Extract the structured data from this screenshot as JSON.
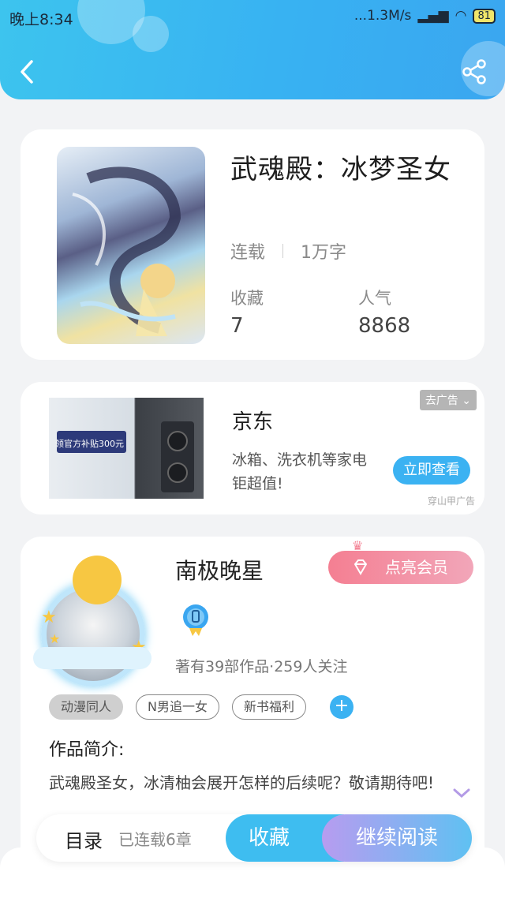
{
  "status_bar": {
    "time": "晚上8:34",
    "network_speed": "...1.3M/s",
    "battery": "81"
  },
  "header": {
    "back_icon": "back-arrow-icon",
    "share_icon": "share-icon",
    "accent_color": "#38b2f2"
  },
  "book": {
    "title": "武魂殿：冰梦圣女",
    "status": "连载",
    "word_count": "1万字",
    "favorites_label": "收藏",
    "favorites_value": "7",
    "popularity_label": "人气",
    "popularity_value": "8868"
  },
  "ad": {
    "image_headline": "领官方补贴300元",
    "title": "京东",
    "description": "冰箱、洗衣机等家电钜超值!",
    "close_label": "去广告",
    "cta_label": "立即查看",
    "source": "穿山甲广告"
  },
  "author": {
    "name": "南极晚星",
    "vip_label": "点亮会员",
    "meta": "著有39部作品·259人关注",
    "tags": [
      "动漫同人",
      "N男追一女",
      "新书福利"
    ],
    "intro_label": "作品简介:",
    "intro_text": "武魂殿圣女，冰清柚会展开怎样的后续呢？敬请期待吧!"
  },
  "bottom_bar": {
    "toc_label": "目录",
    "toc_count": "已连载6章",
    "favorite_label": "收藏",
    "continue_label": "继续阅读"
  }
}
